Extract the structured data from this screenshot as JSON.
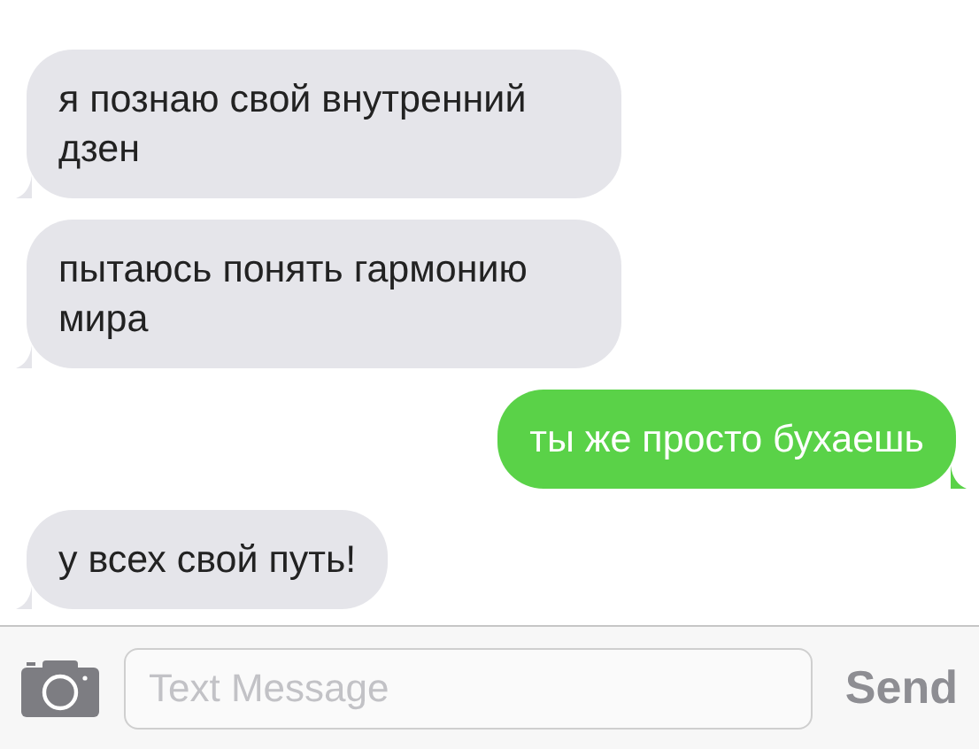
{
  "messages": [
    {
      "kind": "incoming",
      "text": "я познаю свой внутренний дзен"
    },
    {
      "kind": "incoming",
      "text": "пытаюсь понять гармонию мира"
    },
    {
      "kind": "outgoing",
      "text": "ты же просто бухаешь"
    },
    {
      "kind": "incoming",
      "text": "у всех свой путь!"
    }
  ],
  "composer": {
    "placeholder": "Text Message",
    "send": "Send"
  }
}
